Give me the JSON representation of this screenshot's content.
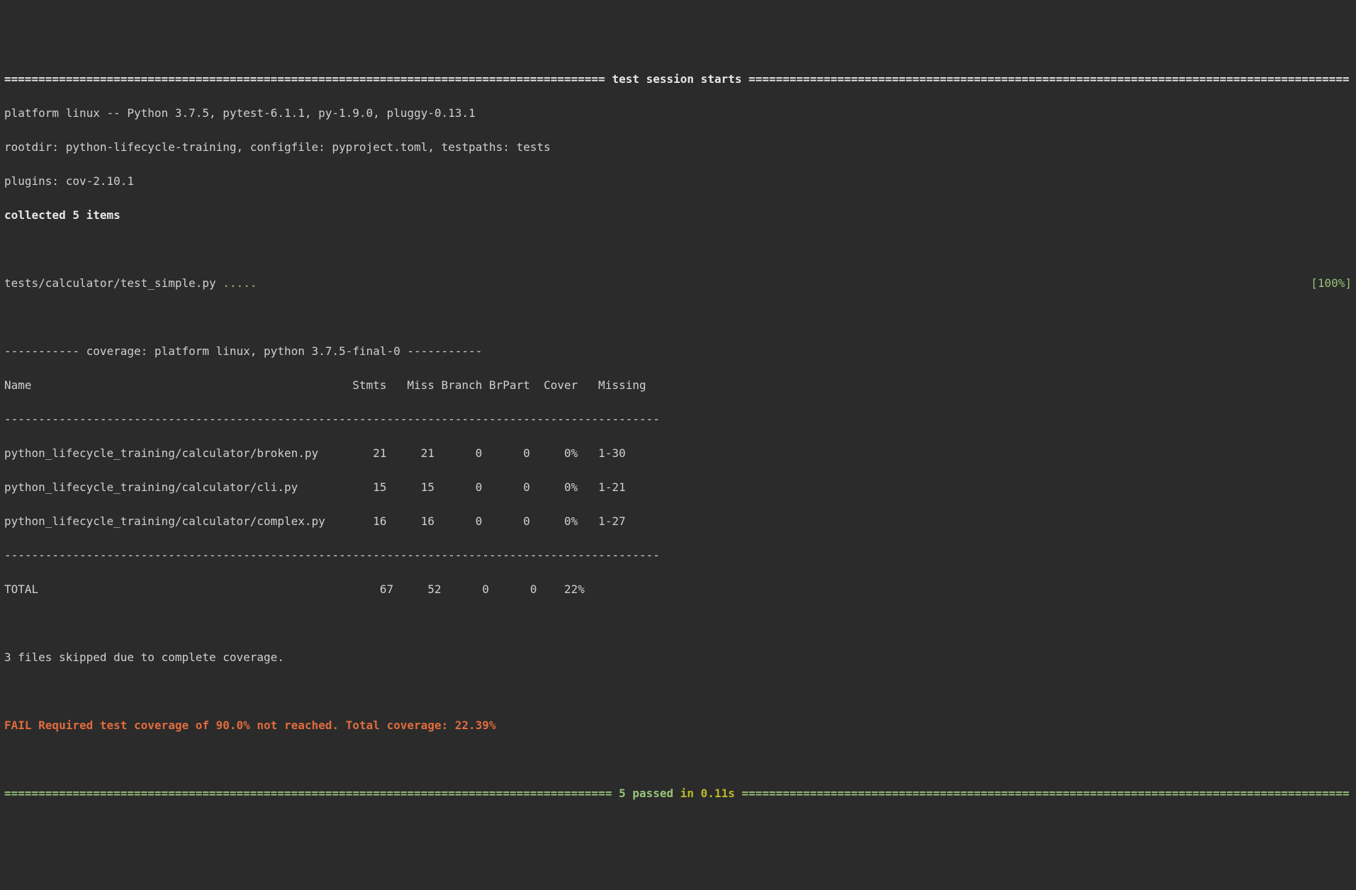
{
  "header": {
    "title": "test session starts",
    "platform_line": "platform linux -- Python 3.7.5, pytest-6.1.1, py-1.9.0, pluggy-0.13.1",
    "rootdir_line": "rootdir: python-lifecycle-training, configfile: pyproject.toml, testpaths: tests",
    "plugins_line": "plugins: cov-2.10.1",
    "collected_line": "collected 5 items"
  },
  "test_run": {
    "file": "tests/calculator/test_simple.py ",
    "dots": ".....",
    "progress": "[100%]"
  },
  "coverage": {
    "header_line": "----------- coverage: platform linux, python 3.7.5-final-0 -----------",
    "columns_line": "Name                                               Stmts   Miss Branch BrPart  Cover   Missing",
    "rule": "------------------------------------------------------------------------------------------------",
    "rows": [
      "python_lifecycle_training/calculator/broken.py        21     21      0      0     0%   1-30",
      "python_lifecycle_training/calculator/cli.py           15     15      0      0     0%   1-21",
      "python_lifecycle_training/calculator/complex.py       16     16      0      0     0%   1-27"
    ],
    "total_line": "TOTAL                                                  67     52      0      0    22%",
    "skipped_line": "3 files skipped due to complete coverage.",
    "fail_line": "FAIL Required test coverage of 90.0% not reached. Total coverage: 22.39%"
  },
  "summary": {
    "passed": "5 passed",
    "timing": " in 0.11s"
  },
  "chart_data": {
    "type": "table",
    "title": "coverage: platform linux, python 3.7.5-final-0",
    "columns": [
      "Name",
      "Stmts",
      "Miss",
      "Branch",
      "BrPart",
      "Cover",
      "Missing"
    ],
    "rows": [
      {
        "Name": "python_lifecycle_training/calculator/broken.py",
        "Stmts": 21,
        "Miss": 21,
        "Branch": 0,
        "BrPart": 0,
        "Cover": "0%",
        "Missing": "1-30"
      },
      {
        "Name": "python_lifecycle_training/calculator/cli.py",
        "Stmts": 15,
        "Miss": 15,
        "Branch": 0,
        "BrPart": 0,
        "Cover": "0%",
        "Missing": "1-21"
      },
      {
        "Name": "python_lifecycle_training/calculator/complex.py",
        "Stmts": 16,
        "Miss": 16,
        "Branch": 0,
        "BrPart": 0,
        "Cover": "0%",
        "Missing": "1-27"
      }
    ],
    "total": {
      "Name": "TOTAL",
      "Stmts": 67,
      "Miss": 52,
      "Branch": 0,
      "BrPart": 0,
      "Cover": "22%"
    },
    "required_coverage": 90.0,
    "total_coverage": 22.39,
    "passed": 5,
    "duration_s": 0.11
  }
}
